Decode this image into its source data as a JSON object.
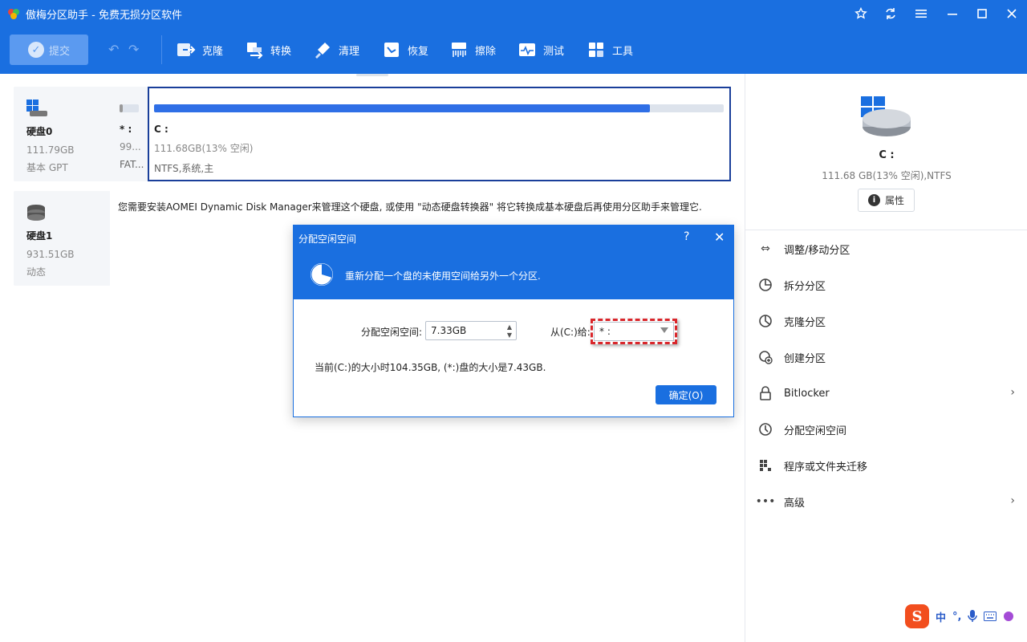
{
  "app": {
    "title": "傲梅分区助手 - 免费无损分区软件"
  },
  "titlebar": {
    "buttons": [
      "star-icon",
      "refresh-icon",
      "menu-icon",
      "minimize-icon",
      "maximize-icon",
      "close-icon"
    ]
  },
  "toolbar": {
    "commit_label": "提交",
    "items": [
      {
        "label": "克隆",
        "icon": "clone-icon"
      },
      {
        "label": "转换",
        "icon": "convert-icon"
      },
      {
        "label": "清理",
        "icon": "cleanup-icon"
      },
      {
        "label": "恢复",
        "icon": "recover-icon"
      },
      {
        "label": "擦除",
        "icon": "wipe-icon"
      },
      {
        "label": "测试",
        "icon": "test-icon"
      },
      {
        "label": "工具",
        "icon": "tools-icon"
      }
    ]
  },
  "disks": [
    {
      "name": "硬盘0",
      "size": "111.79GB",
      "type": "基本 GPT",
      "small_partition": {
        "label": "* :",
        "size": "99...",
        "fs": "FAT..."
      },
      "main_partition": {
        "label": "C :",
        "size": "111.68GB(13% 空闲)",
        "fs": "NTFS,系统,主",
        "used_fraction": 0.87
      }
    },
    {
      "name": "硬盘1",
      "size": "931.51GB",
      "type": "动态",
      "message": "您需要安装AOMEI Dynamic Disk Manager来管理这个硬盘, 或使用 \"动态硬盘转换器\" 将它转换成基本硬盘后再使用分区助手来管理它."
    }
  ],
  "side": {
    "label": "C :",
    "info": "111.68 GB(13% 空闲),NTFS",
    "properties_label": "属性",
    "ops": [
      {
        "label": "调整/移动分区",
        "icon": "resize-icon",
        "chevron": false
      },
      {
        "label": "拆分分区",
        "icon": "split-icon",
        "chevron": false
      },
      {
        "label": "克隆分区",
        "icon": "clone-partition-icon",
        "chevron": false
      },
      {
        "label": "创建分区",
        "icon": "create-partition-icon",
        "chevron": false
      },
      {
        "label": "Bitlocker",
        "icon": "lock-icon",
        "chevron": true
      },
      {
        "label": "分配空闲空间",
        "icon": "allocate-icon",
        "chevron": false
      },
      {
        "label": "程序或文件夹迁移",
        "icon": "migrate-icon",
        "chevron": false
      },
      {
        "label": "高级",
        "icon": "more-icon",
        "chevron": true
      }
    ]
  },
  "ime": {
    "logo": "S",
    "items": [
      "中",
      "°,"
    ]
  },
  "dialog": {
    "title": "分配空闲空间",
    "help": "?",
    "description": "重新分配一个盘的未使用空间给另外一个分区.",
    "free_space_label": "分配空闲空间:",
    "free_space_value": "7.33GB",
    "from_label": "从(C:)给:",
    "target_value": "* :",
    "status": "当前(C:)的大小时104.35GB, (*:)盘的大小是7.43GB.",
    "ok_label": "确定(O)"
  }
}
